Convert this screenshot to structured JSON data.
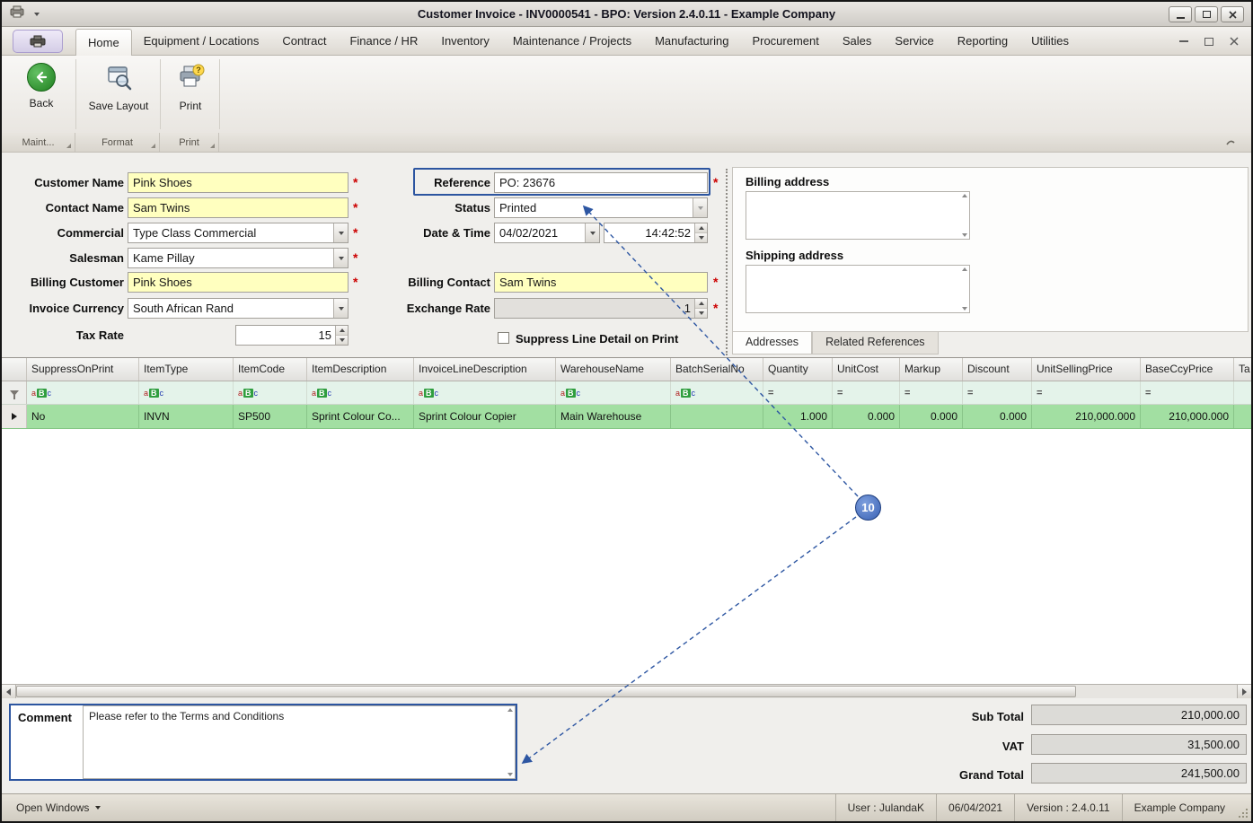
{
  "window": {
    "title": "Customer Invoice - INV0000541 - BPO: Version 2.4.0.11 - Example Company"
  },
  "menu": {
    "tabs": [
      {
        "label": "Home"
      },
      {
        "label": "Equipment / Locations"
      },
      {
        "label": "Contract"
      },
      {
        "label": "Finance / HR"
      },
      {
        "label": "Inventory"
      },
      {
        "label": "Maintenance / Projects"
      },
      {
        "label": "Manufacturing"
      },
      {
        "label": "Procurement"
      },
      {
        "label": "Sales"
      },
      {
        "label": "Service"
      },
      {
        "label": "Reporting"
      },
      {
        "label": "Utilities"
      }
    ]
  },
  "toolbar": {
    "back_label": "Back",
    "save_layout_label": "Save Layout",
    "print_label": "Print",
    "groups": [
      {
        "label": "Maint..."
      },
      {
        "label": "Format"
      },
      {
        "label": "Print"
      }
    ]
  },
  "form": {
    "required_marker": "*",
    "customer_name": {
      "label": "Customer Name",
      "value": "Pink Shoes"
    },
    "contact_name": {
      "label": "Contact Name",
      "value": "Sam Twins"
    },
    "commercial": {
      "label": "Commercial",
      "value": "Type Class Commercial"
    },
    "salesman": {
      "label": "Salesman",
      "value": "Kame Pillay"
    },
    "billing_customer": {
      "label": "Billing Customer",
      "value": "Pink Shoes"
    },
    "invoice_currency": {
      "label": "Invoice Currency",
      "value": "South African Rand"
    },
    "tax_rate": {
      "label": "Tax Rate",
      "value": "15"
    },
    "reference": {
      "label": "Reference",
      "value": "PO: 23676"
    },
    "status": {
      "label": "Status",
      "value": "Printed"
    },
    "date_time": {
      "label": "Date & Time",
      "date": "04/02/2021",
      "time": "14:42:52"
    },
    "billing_contact": {
      "label": "Billing Contact",
      "value": "Sam Twins"
    },
    "exchange_rate": {
      "label": "Exchange Rate",
      "value": "1"
    },
    "suppress_line_detail": {
      "label": "Suppress Line Detail on Print",
      "checked": false
    }
  },
  "addresses_panel": {
    "billing_label": "Billing address",
    "shipping_label": "Shipping address",
    "tabs": [
      {
        "label": "Addresses"
      },
      {
        "label": "Related References"
      }
    ]
  },
  "grid": {
    "columns": [
      {
        "label": "SuppressOnPrint"
      },
      {
        "label": "ItemType"
      },
      {
        "label": "ItemCode"
      },
      {
        "label": "ItemDescription"
      },
      {
        "label": "InvoiceLineDescription"
      },
      {
        "label": "WarehouseName"
      },
      {
        "label": "BatchSerialNo"
      },
      {
        "label": "Quantity"
      },
      {
        "label": "UnitCost"
      },
      {
        "label": "Markup"
      },
      {
        "label": "Discount"
      },
      {
        "label": "UnitSellingPrice"
      },
      {
        "label": "BaseCcyPrice"
      },
      {
        "label": "Ta"
      }
    ],
    "filter_icon_text": {
      "a": "a",
      "b": "B",
      "c": "c"
    },
    "filter_icon_numeric": "=",
    "row": {
      "cells": [
        "No",
        "INVN",
        "SP500",
        "Sprint Colour Co...",
        "Sprint Colour Copier",
        "Main Warehouse",
        "",
        "1.000",
        "0.000",
        "0.000",
        "0.000",
        "210,000.000",
        "210,000.000",
        ""
      ]
    }
  },
  "footer": {
    "comment_label": "Comment",
    "comment_text": "Please refer to the Terms and Conditions",
    "totals": [
      {
        "label": "Sub Total",
        "value": "210,000.00"
      },
      {
        "label": "VAT",
        "value": "31,500.00"
      },
      {
        "label": "Grand Total",
        "value": "241,500.00"
      }
    ]
  },
  "statusbar": {
    "open_windows": "Open Windows",
    "user": "User : JulandaK",
    "date": "06/04/2021",
    "version": "Version : 2.4.0.11",
    "company": "Example Company"
  },
  "annotation": {
    "number": "10"
  },
  "icons": {
    "print_badge": "?"
  }
}
